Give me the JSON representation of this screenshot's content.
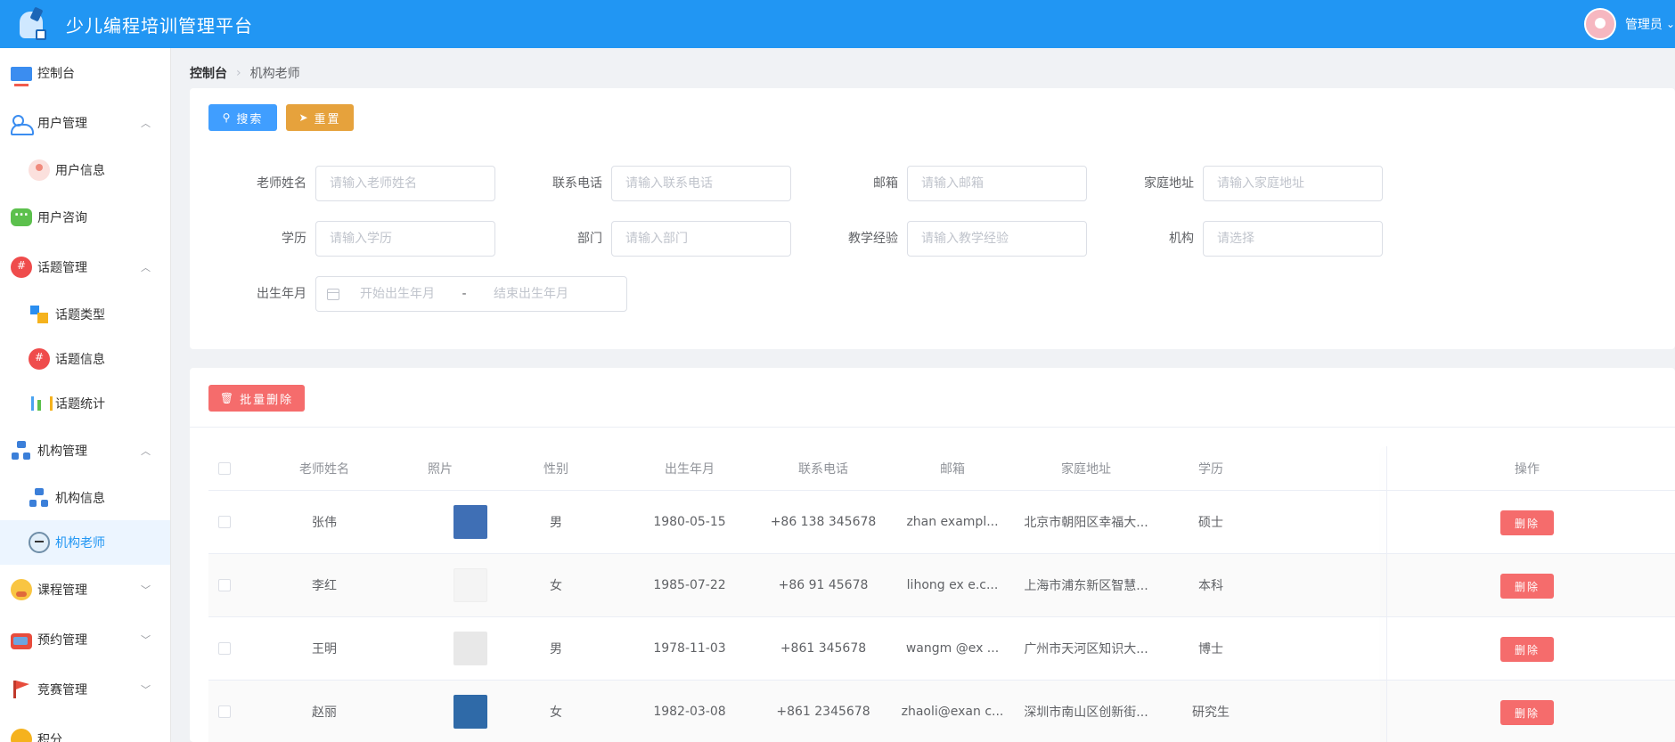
{
  "header": {
    "title": "少儿编程培训管理平台",
    "user_name": "管理员"
  },
  "sidebar": {
    "items": [
      {
        "label": "控制台",
        "icon": "monitor-icon"
      },
      {
        "label": "用户管理",
        "icon": "users-icon",
        "expanded": true
      },
      {
        "label": "用户信息",
        "icon": "person-icon",
        "sub": true
      },
      {
        "label": "用户咨询",
        "icon": "chat-icon"
      },
      {
        "label": "话题管理",
        "icon": "topic-icon",
        "expanded": true
      },
      {
        "label": "话题类型",
        "icon": "grid-icon",
        "sub": true
      },
      {
        "label": "话题信息",
        "icon": "topic-icon",
        "sub": true
      },
      {
        "label": "话题统计",
        "icon": "stats-icon",
        "sub": true
      },
      {
        "label": "机构管理",
        "icon": "org-icon",
        "expanded": true
      },
      {
        "label": "机构信息",
        "icon": "org-icon",
        "sub": true
      },
      {
        "label": "机构老师",
        "icon": "teacher-icon",
        "sub": true,
        "active": true
      },
      {
        "label": "课程管理",
        "icon": "course-icon",
        "expanded": false
      },
      {
        "label": "预约管理",
        "icon": "book-icon",
        "expanded": false
      },
      {
        "label": "竞赛管理",
        "icon": "flag-icon",
        "expanded": false
      },
      {
        "label": "积分",
        "icon": "points-icon"
      }
    ]
  },
  "breadcrumb": {
    "root": "控制台",
    "current": "机构老师"
  },
  "search": {
    "search_label": "搜索",
    "reset_label": "重置",
    "fields": {
      "name": {
        "label": "老师姓名",
        "placeholder": "请输入老师姓名"
      },
      "phone": {
        "label": "联系电话",
        "placeholder": "请输入联系电话"
      },
      "email": {
        "label": "邮箱",
        "placeholder": "请输入邮箱"
      },
      "address": {
        "label": "家庭地址",
        "placeholder": "请输入家庭地址"
      },
      "education": {
        "label": "学历",
        "placeholder": "请输入学历"
      },
      "department": {
        "label": "部门",
        "placeholder": "请输入部门"
      },
      "experience": {
        "label": "教学经验",
        "placeholder": "请输入教学经验"
      },
      "org": {
        "label": "机构",
        "placeholder": "请选择"
      },
      "birth": {
        "label": "出生年月",
        "start_placeholder": "开始出生年月",
        "end_placeholder": "结束出生年月",
        "separator": "-"
      }
    }
  },
  "table": {
    "batch_delete_label": "批量删除",
    "delete_label": "删除",
    "columns": {
      "name": "老师姓名",
      "photo": "照片",
      "gender": "性别",
      "birth": "出生年月",
      "phone": "联系电话",
      "email": "邮箱",
      "address": "家庭地址",
      "education": "学历",
      "action": "操作"
    },
    "rows": [
      {
        "name": "张伟",
        "gender": "男",
        "birth": "1980-05-15",
        "phone": "+86 138 345678",
        "email": "zhan   exampl...",
        "address": "北京市朝阳区幸福大...",
        "education": "硕士",
        "photo_color": "#3f6fb5"
      },
      {
        "name": "李红",
        "gender": "女",
        "birth": "1985-07-22",
        "phone": "+86 91 45678",
        "email": "lihong ex   e.c...",
        "address": "上海市浦东新区智慧...",
        "education": "本科",
        "photo_color": "#f4f4f4"
      },
      {
        "name": "王明",
        "gender": "男",
        "birth": "1978-11-03",
        "phone": "+861 345678",
        "email": "wangm   @ex  ...",
        "address": "广州市天河区知识大...",
        "education": "博士",
        "photo_color": "#e8e8e8"
      },
      {
        "name": "赵丽",
        "gender": "女",
        "birth": "1982-03-08",
        "phone": "+861 2345678",
        "email": "zhaoli@exan   c...",
        "address": "深圳市南山区创新街...",
        "education": "研究生",
        "photo_color": "#2f6aa8"
      }
    ]
  }
}
